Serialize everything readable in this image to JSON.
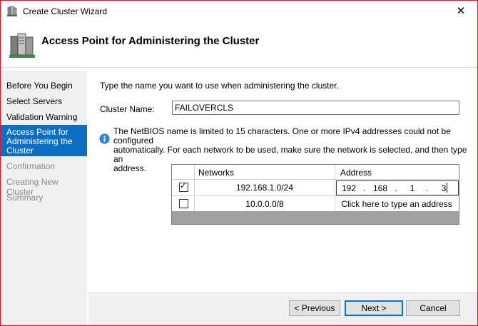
{
  "window": {
    "title": "Create Cluster Wizard",
    "close_glyph": "✕"
  },
  "header": {
    "title": "Access Point for Administering the Cluster",
    "icon": "cluster-servers-icon"
  },
  "sidebar": {
    "items": [
      {
        "label": "Before You Begin",
        "state": "normal"
      },
      {
        "label": "Select Servers",
        "state": "normal"
      },
      {
        "label": "Validation Warning",
        "state": "normal"
      },
      {
        "label": "Access Point for Administering the Cluster",
        "state": "active"
      },
      {
        "label": "Confirmation",
        "state": "disabled"
      },
      {
        "label": "Creating New Cluster",
        "state": "disabled"
      },
      {
        "label": "Summary",
        "state": "disabled"
      }
    ]
  },
  "main": {
    "instruction": "Type the name you want to use when administering the cluster.",
    "cluster_name_label": "Cluster Name:",
    "cluster_name_value": "FAILOVERCLS",
    "info_line1": "The NetBIOS name is limited to 15 characters.  One or more IPv4 addresses could not be configured",
    "info_line2": "automatically.  For each network to be used, make sure the network is selected, and then type an",
    "info_line3": "address.",
    "table": {
      "headers": {
        "networks": "Networks",
        "address": "Address"
      },
      "rows": [
        {
          "checked": true,
          "network": "192.168.1.0/24",
          "ip": [
            "192",
            "168",
            "1",
            "3"
          ]
        },
        {
          "checked": false,
          "network": "10.0.0.0/8",
          "address_hint": "Click here to type an address"
        }
      ],
      "check_glyph": "✓",
      "ip_separator": "."
    }
  },
  "footer": {
    "previous": "< Previous",
    "next": "Next >",
    "cancel": "Cancel"
  },
  "colors": {
    "selection": "#0b6fc6",
    "window_border": "#e81123",
    "sidebar_bg": "#f0f0f0",
    "table_footer": "#a0a0a0"
  }
}
